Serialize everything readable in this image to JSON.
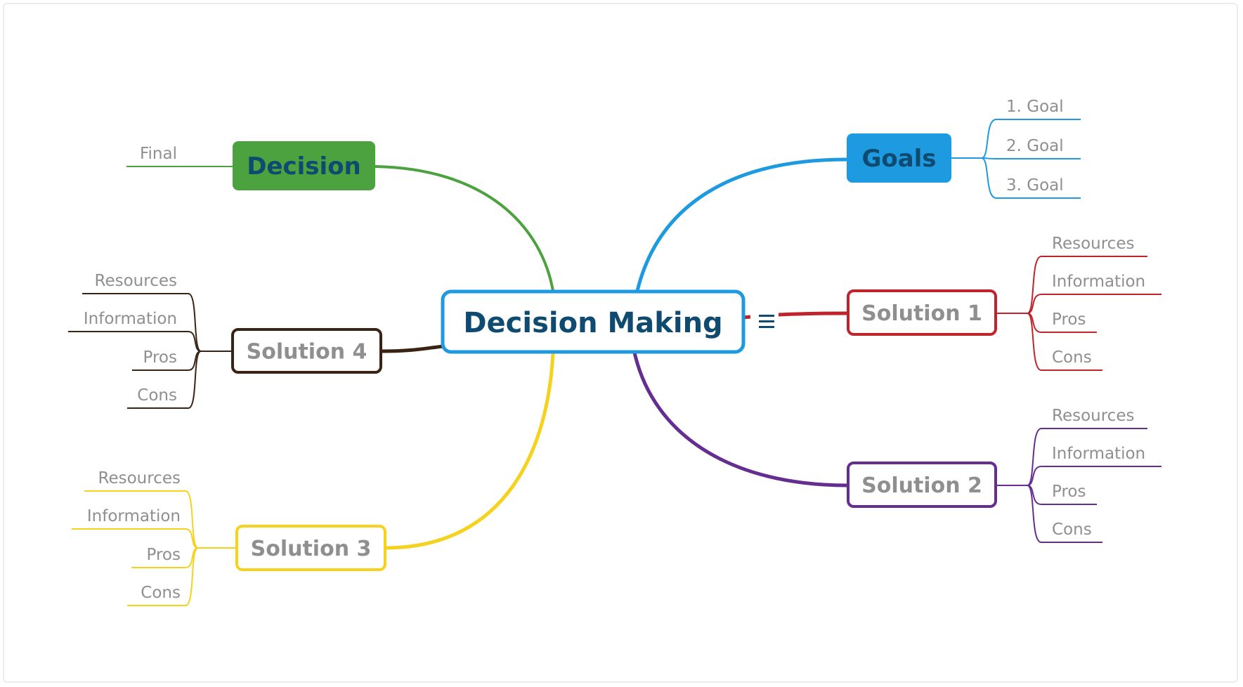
{
  "mindmap": {
    "central": {
      "label": "Decision Making",
      "text_color": "#0f4a70",
      "border_color": "#1e9ae0",
      "has_notes_icon": true,
      "notes_icon": "notes-icon"
    },
    "branches": [
      {
        "id": "goals",
        "label": "Goals",
        "color": "#1e9ae0",
        "style": "filled",
        "text_color": "#0f4a70",
        "side": "right",
        "children": [
          "1. Goal",
          "2. Goal",
          "3. Goal"
        ]
      },
      {
        "id": "solution-1",
        "label": "Solution 1",
        "color": "#c0232a",
        "style": "outlined",
        "text_color": "#8f8f8f",
        "side": "right",
        "children": [
          "Resources",
          "Information",
          "Pros",
          "Cons"
        ]
      },
      {
        "id": "solution-2",
        "label": "Solution 2",
        "color": "#662d91",
        "style": "outlined",
        "text_color": "#8f8f8f",
        "side": "right",
        "children": [
          "Resources",
          "Information",
          "Pros",
          "Cons"
        ]
      },
      {
        "id": "decision",
        "label": "Decision",
        "color": "#4ba23f",
        "style": "filled",
        "text_color": "#0f4a70",
        "side": "left",
        "children": [
          "Final"
        ]
      },
      {
        "id": "solution-4",
        "label": "Solution 4",
        "color": "#3b2314",
        "style": "outlined",
        "text_color": "#8f8f8f",
        "side": "left",
        "children": [
          "Resources",
          "Information",
          "Pros",
          "Cons"
        ]
      },
      {
        "id": "solution-3",
        "label": "Solution 3",
        "color": "#f5d21e",
        "style": "outlined",
        "text_color": "#8f8f8f",
        "side": "left",
        "children": [
          "Resources",
          "Information",
          "Pros",
          "Cons"
        ]
      }
    ]
  }
}
